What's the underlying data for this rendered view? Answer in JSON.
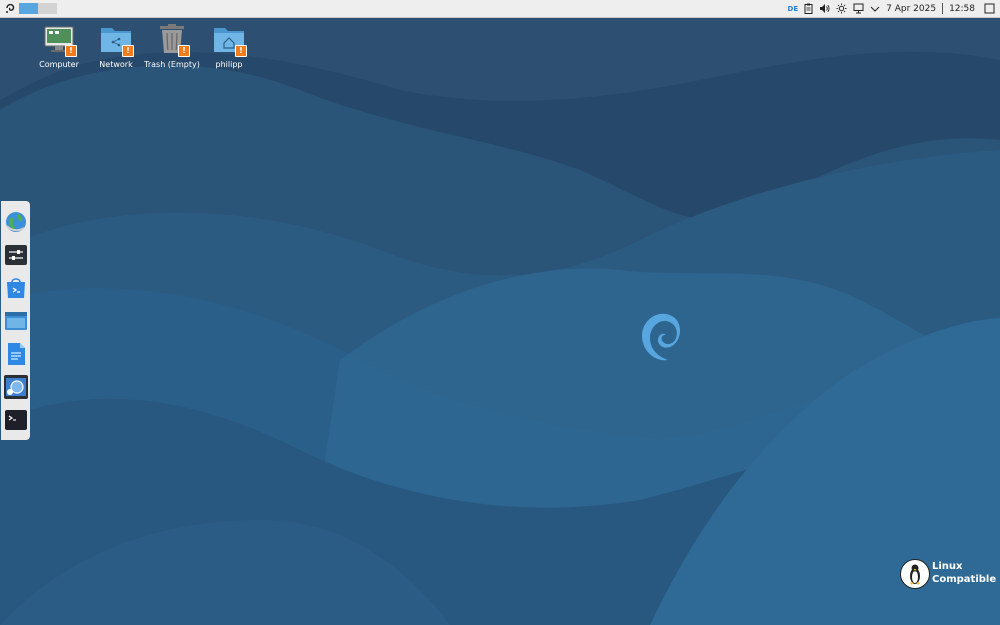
{
  "top_panel": {
    "menu_icon": "app-menu-icon",
    "workspaces": [
      "workspace-1",
      "workspace-2"
    ],
    "keyboard_layout": "DE",
    "tray_icons": [
      "clipboard-icon",
      "volume-icon",
      "brightness-icon",
      "network-icon",
      "chevron-down-icon"
    ],
    "date": "7 Apr 2025",
    "time": "12:58",
    "show_desktop_icon": "show-desktop-icon"
  },
  "desktop_icons": [
    {
      "label": "Computer",
      "icon": "computer-icon"
    },
    {
      "label": "Network",
      "icon": "network-folder-icon"
    },
    {
      "label": "Trash (Empty)",
      "icon": "trash-icon"
    },
    {
      "label": "philipp",
      "icon": "home-folder-icon"
    }
  ],
  "dock": {
    "items": [
      "web-browser-icon",
      "settings-icon",
      "software-store-icon",
      "file-manager-icon",
      "text-editor-icon",
      "screenshot-icon",
      "terminal-icon"
    ]
  },
  "logo": {
    "line1": "Linux",
    "line2": "Compatible"
  },
  "colors": {
    "panel_bg": "#eeeeee",
    "wallpaper_dark": "#27496a",
    "wallpaper_light": "#2f6590",
    "accent": "#57a6e0",
    "badge": "#f07c1c"
  }
}
